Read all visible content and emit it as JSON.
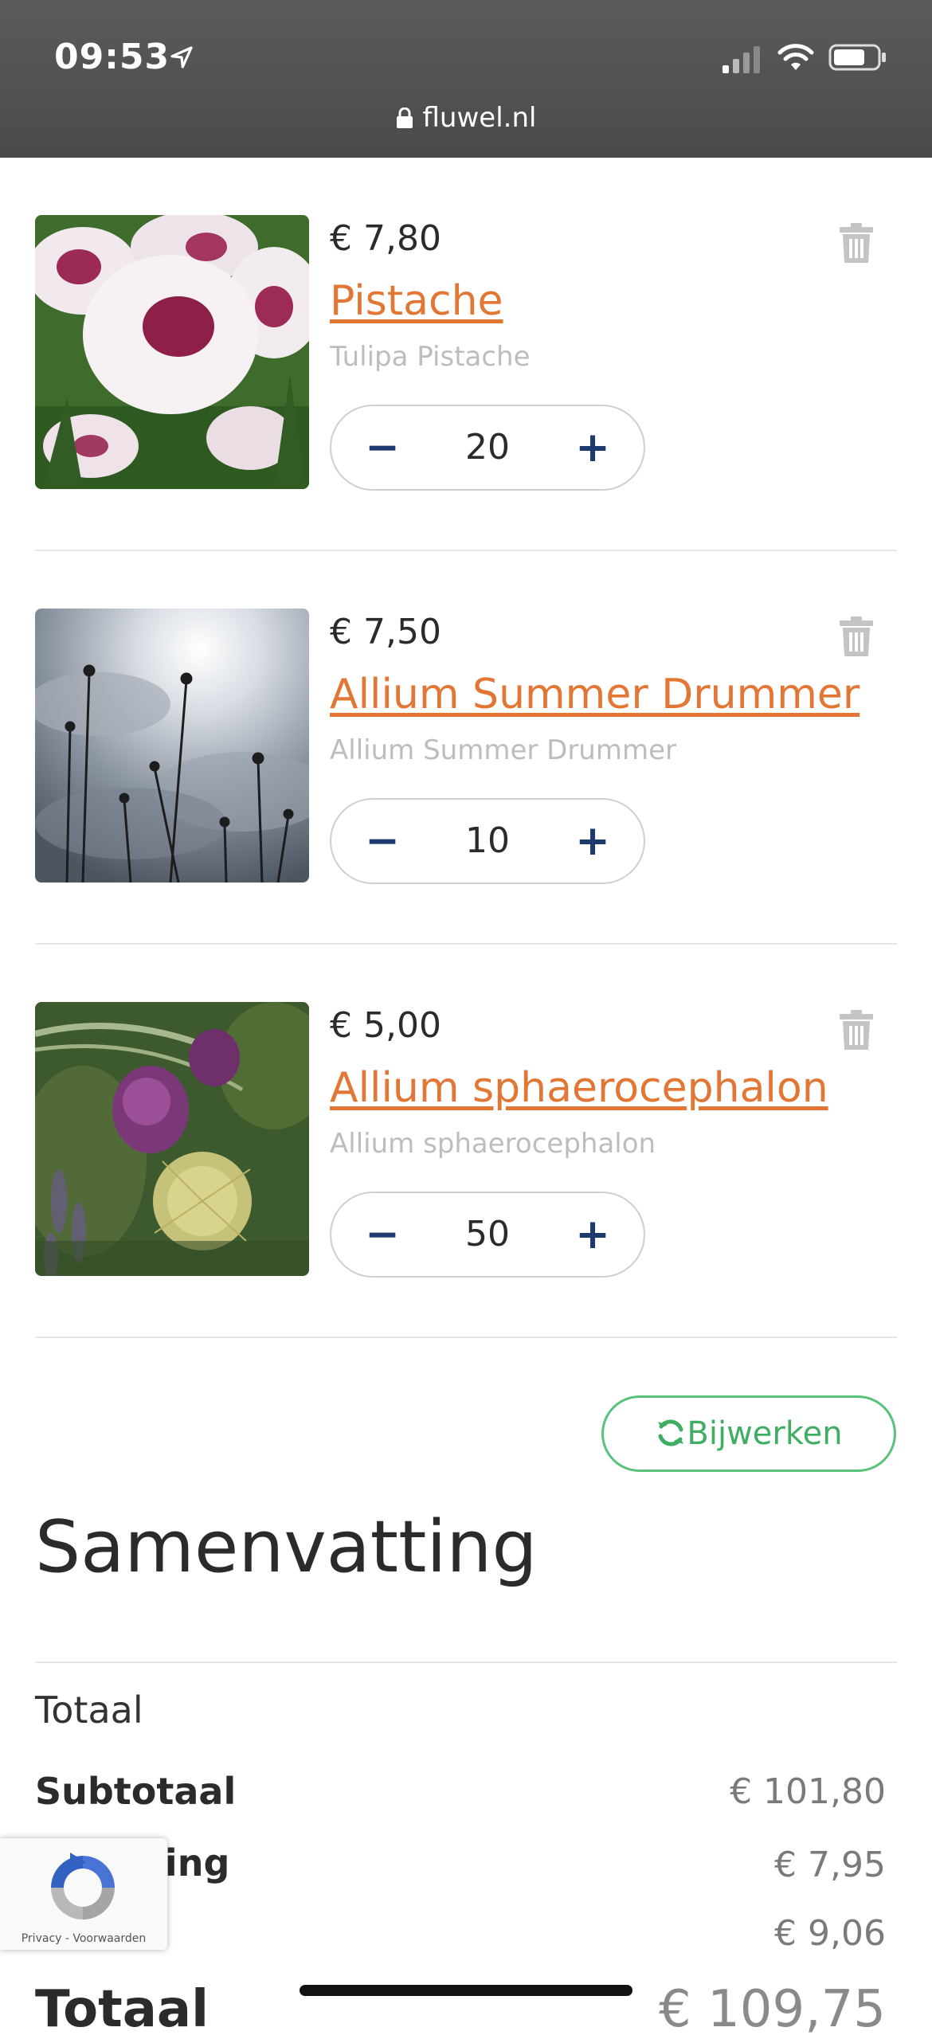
{
  "status_bar": {
    "time": "09:53"
  },
  "browser": {
    "url": "fluwel.nl"
  },
  "cart": {
    "items": [
      {
        "price": "€ 7,80",
        "name": "Pistache",
        "latin": "Tulipa Pistache",
        "quantity": "20"
      },
      {
        "price": "€ 7,50",
        "name": "Allium Summer Drummer",
        "latin": "Allium Summer Drummer",
        "quantity": "10"
      },
      {
        "price": "€ 5,00",
        "name": "Allium sphaerocephalon",
        "latin": "Allium sphaerocephalon",
        "quantity": "50"
      }
    ],
    "stepper": {
      "minus": "−",
      "plus": "+"
    },
    "update_label": "Bijwerken"
  },
  "summary": {
    "title": "Samenvatting",
    "section_label": "Totaal",
    "rows": [
      {
        "label": "Subtotaal",
        "value": "€ 101,80"
      },
      {
        "label": "ding",
        "value": "€ 7,95"
      },
      {
        "label": "",
        "value": "€ 9,06"
      }
    ],
    "total_label": "Totaal",
    "total_value": "€ 109,75"
  },
  "recaptcha": {
    "text": "Privacy - Voorwaarden"
  },
  "colors": {
    "accent_orange": "#e27735",
    "stepper_blue": "#1c3a6e",
    "update_green": "#3fae63"
  }
}
